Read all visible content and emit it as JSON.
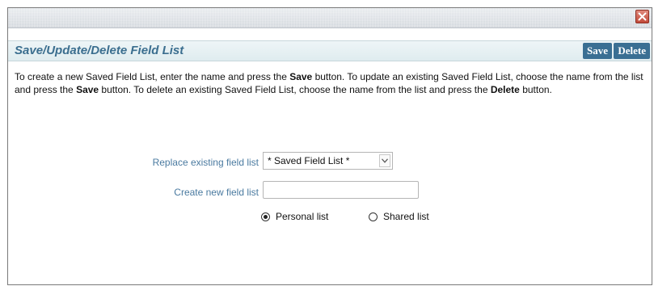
{
  "dialog": {
    "close_icon": "close-icon"
  },
  "panel": {
    "title": "Save/Update/Delete Field List",
    "save_label": "Save",
    "delete_label": "Delete"
  },
  "instructions": {
    "part1": "To create a new Saved Field List, enter the name and press the ",
    "save_word_1": "Save",
    "part2": " button. To update an existing Saved Field List, choose the name from the list and press the ",
    "save_word_2": "Save",
    "part3": " button. To delete an existing Saved Field List, choose the name from the list and press the ",
    "delete_word": "Delete",
    "part4": " button."
  },
  "form": {
    "replace_label": "Replace existing field list",
    "replace_selected": "* Saved Field List *",
    "create_label": "Create new field list",
    "create_value": "",
    "radio_personal_label": "Personal list",
    "radio_shared_label": "Shared list",
    "selected_list_type": "Personal list"
  },
  "colors": {
    "title_text": "#3b6e8f",
    "button_bg": "#3a6f93",
    "label_text": "#4a7aa0",
    "header_bg": "#dfecef",
    "close_button": "#c24a3a"
  }
}
